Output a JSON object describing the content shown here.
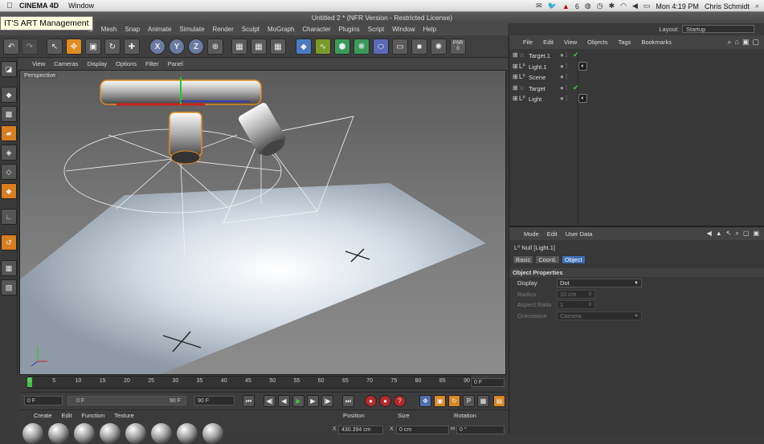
{
  "mac_menubar": {
    "app_name": "CINEMA 4D",
    "menu": "Window",
    "battery_count": "6",
    "clock": "Mon 4:19 PM",
    "user": "Chris Schmidt"
  },
  "window": {
    "title": "Untitled 2 * (NFR Version - Restricted License)"
  },
  "overlay_label": "IT'S ART Management",
  "main_menu": [
    "Mesh",
    "Snap",
    "Animate",
    "Simulate",
    "Render",
    "Sculpt",
    "MoGraph",
    "Character",
    "Plugins",
    "Script",
    "Window",
    "Help"
  ],
  "main_menu_partial": "ls",
  "layout": {
    "label": "Layout:",
    "value": "Startup"
  },
  "toolbar": {
    "x": "X",
    "y": "Y",
    "z": "Z",
    "psr_label": "PSR",
    "psr_value": "0"
  },
  "viewport": {
    "menu": [
      "View",
      "Cameras",
      "Display",
      "Options",
      "Filter",
      "Panel"
    ],
    "label": "Perspective"
  },
  "timeline": {
    "ticks": [
      "0",
      "5",
      "10",
      "15",
      "20",
      "25",
      "30",
      "35",
      "40",
      "45",
      "50",
      "55",
      "60",
      "65",
      "70",
      "75",
      "80",
      "85",
      "90"
    ],
    "current_frame": "0 F"
  },
  "transport": {
    "start": "0 F",
    "range_start": "0 F",
    "range_end": "90 F",
    "end": "90 F"
  },
  "material_panel": {
    "menu": [
      "Create",
      "Edit",
      "Function",
      "Texture"
    ]
  },
  "coord_panel": {
    "headers": [
      "Position",
      "Size",
      "Rotation"
    ],
    "x_label": "X",
    "x_pos": "430.394 cm",
    "size_label": "X",
    "x_size": "0 cm",
    "rot_label": "H",
    "h_rot": "0 °"
  },
  "object_manager": {
    "menu": [
      "File",
      "Edit",
      "View",
      "Objects",
      "Tags",
      "Bookmarks"
    ],
    "objects": [
      {
        "name": "Target.1",
        "icon": "star-icon",
        "check": "✔",
        "tag": ""
      },
      {
        "name": "Light.1",
        "icon": "null-icon",
        "check": "",
        "tag": "◐"
      },
      {
        "name": "Scene",
        "icon": "null-icon",
        "check": "",
        "tag": ""
      },
      {
        "name": "Target",
        "icon": "star-icon",
        "check": "✔",
        "tag": ""
      },
      {
        "name": "Light",
        "icon": "null-icon",
        "check": "",
        "tag": "◐"
      }
    ]
  },
  "attribute_manager": {
    "menu": [
      "Mode",
      "Edit",
      "User Data"
    ],
    "object_title": "Null [Light.1]",
    "tabs": [
      "Basic",
      "Coord.",
      "Object"
    ],
    "active_tab": "Object",
    "section": "Object Properties",
    "props": [
      {
        "label": "Display",
        "value": "Dot",
        "enabled": true,
        "type": "dropdown"
      },
      {
        "label": "Radius",
        "value": "10 cm",
        "enabled": false,
        "type": "number"
      },
      {
        "label": "Aspect Ratio",
        "value": "1",
        "enabled": false,
        "type": "number"
      },
      {
        "label": "Orientation",
        "value": "Camera",
        "enabled": false,
        "type": "dropdown"
      }
    ]
  },
  "colors": {
    "accent": "#3d6db5",
    "orange": "#e08c20",
    "check": "#3fc43f"
  }
}
